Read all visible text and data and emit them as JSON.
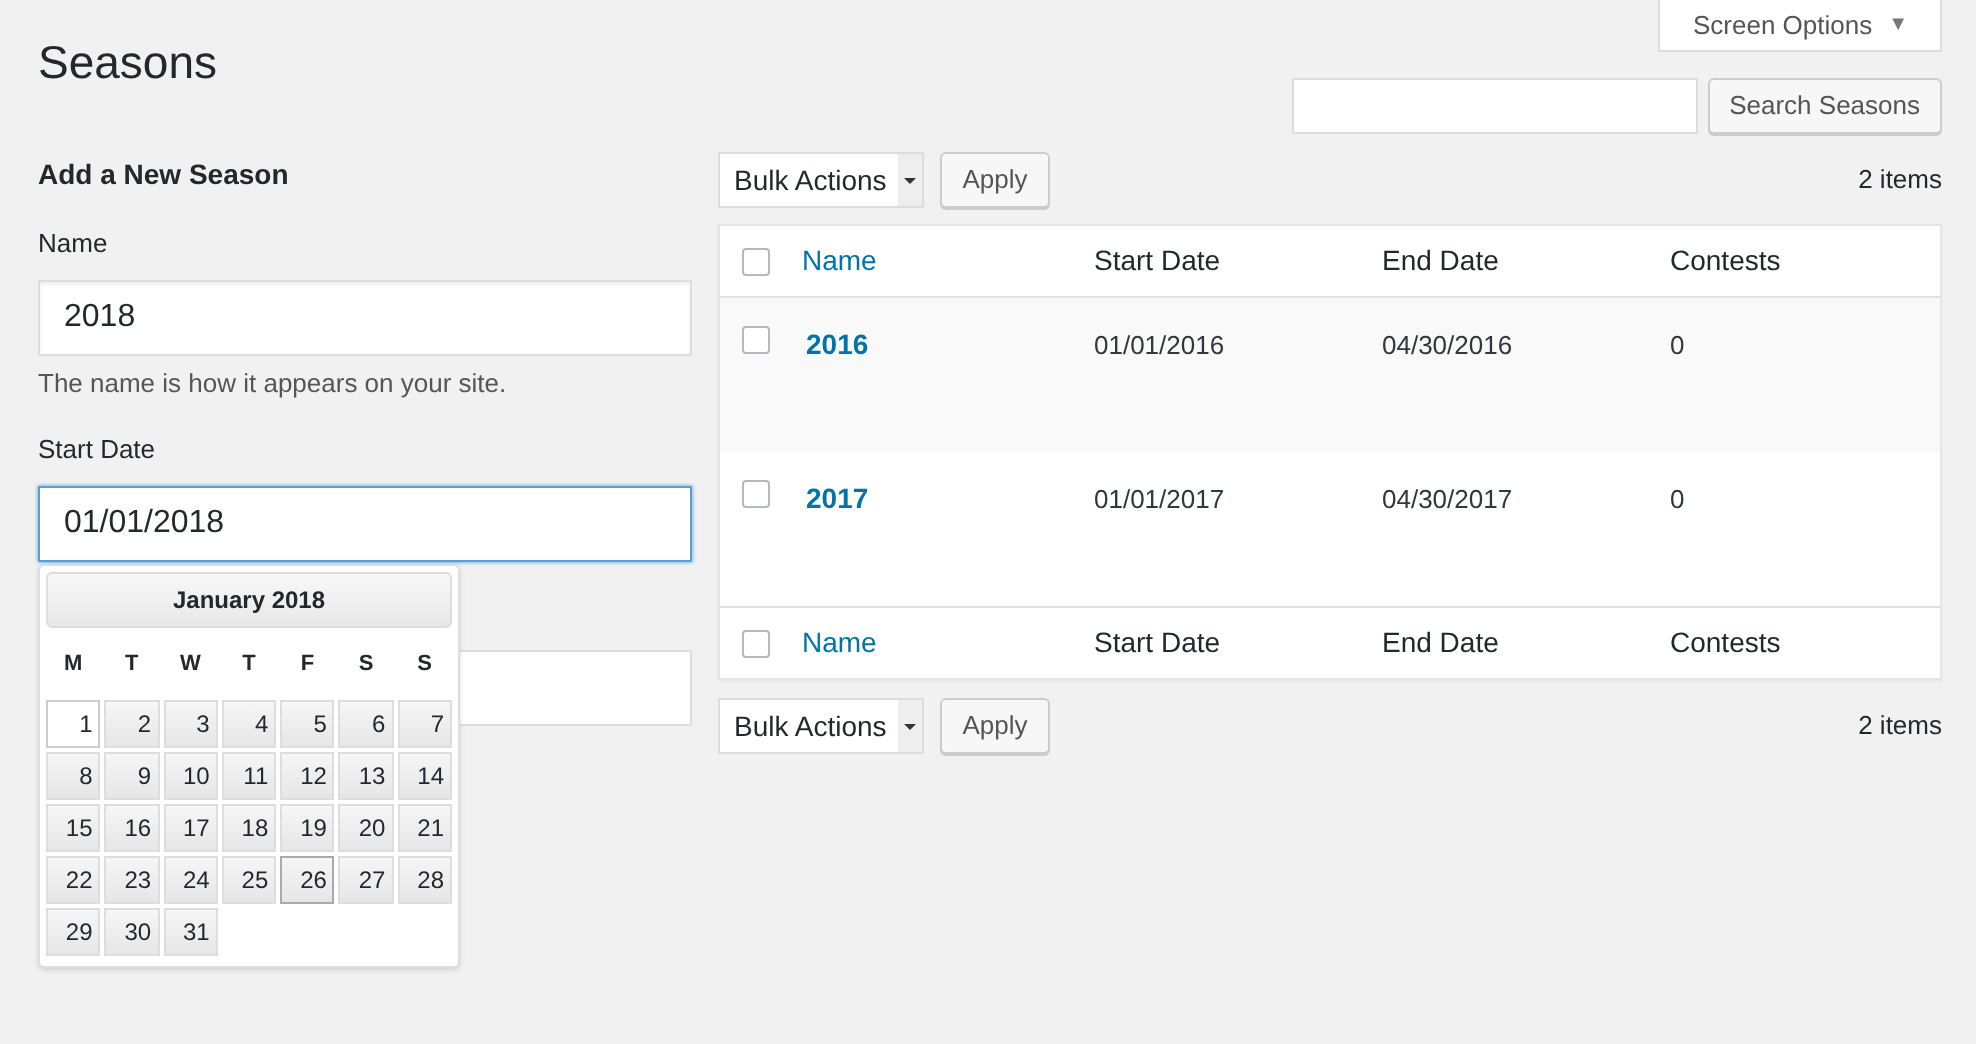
{
  "screen_options": {
    "label": "Screen Options",
    "caret": "▼"
  },
  "page_title": "Seasons",
  "search": {
    "button": "Search Seasons"
  },
  "form": {
    "heading": "Add a New Season",
    "name_field": {
      "label": "Name",
      "value": "2018",
      "hint": "The name is how it appears on your site."
    },
    "start_field": {
      "label": "Start Date",
      "value": "01/01/2018",
      "focused": true
    }
  },
  "datepicker": {
    "month": "January 2018",
    "weekdays": [
      "M",
      "T",
      "W",
      "T",
      "F",
      "S",
      "S"
    ],
    "days": [
      {
        "label": "1",
        "selected": true,
        "today": false
      },
      {
        "label": "2",
        "selected": false,
        "today": false
      },
      {
        "label": "3",
        "selected": false,
        "today": false
      },
      {
        "label": "4",
        "selected": false,
        "today": false
      },
      {
        "label": "5",
        "selected": false,
        "today": false
      },
      {
        "label": "6",
        "selected": false,
        "today": false
      },
      {
        "label": "7",
        "selected": false,
        "today": false
      },
      {
        "label": "8",
        "selected": false,
        "today": false
      },
      {
        "label": "9",
        "selected": false,
        "today": false
      },
      {
        "label": "10",
        "selected": false,
        "today": false
      },
      {
        "label": "11",
        "selected": false,
        "today": false
      },
      {
        "label": "12",
        "selected": false,
        "today": false
      },
      {
        "label": "13",
        "selected": false,
        "today": false
      },
      {
        "label": "14",
        "selected": false,
        "today": false
      },
      {
        "label": "15",
        "selected": false,
        "today": false
      },
      {
        "label": "16",
        "selected": false,
        "today": false
      },
      {
        "label": "17",
        "selected": false,
        "today": false
      },
      {
        "label": "18",
        "selected": false,
        "today": false
      },
      {
        "label": "19",
        "selected": false,
        "today": false
      },
      {
        "label": "20",
        "selected": false,
        "today": false
      },
      {
        "label": "21",
        "selected": false,
        "today": false
      },
      {
        "label": "22",
        "selected": false,
        "today": false
      },
      {
        "label": "23",
        "selected": false,
        "today": false
      },
      {
        "label": "24",
        "selected": false,
        "today": false
      },
      {
        "label": "25",
        "selected": false,
        "today": false
      },
      {
        "label": "26",
        "selected": false,
        "today": true
      },
      {
        "label": "27",
        "selected": false,
        "today": false
      },
      {
        "label": "28",
        "selected": false,
        "today": false
      },
      {
        "label": "29",
        "selected": false,
        "today": false
      },
      {
        "label": "30",
        "selected": false,
        "today": false
      },
      {
        "label": "31",
        "selected": false,
        "today": false
      }
    ]
  },
  "top_actions": {
    "bulk": "Bulk Actions",
    "apply": "Apply",
    "count": "2 items"
  },
  "table": {
    "header_checked": false,
    "footer_checked": false,
    "columns": [
      "Name",
      "Start Date",
      "End Date",
      "Contests"
    ],
    "rows": [
      {
        "checked": false,
        "cells": [
          "2016",
          "01/01/2016",
          "04/30/2016",
          "0"
        ]
      },
      {
        "checked": false,
        "cells": [
          "2017",
          "01/01/2017",
          "04/30/2017",
          "0"
        ]
      }
    ],
    "footer_columns": [
      "Name",
      "Start Date",
      "End Date",
      "Contests"
    ]
  },
  "bottom_actions": {
    "bulk": "Bulk Actions",
    "apply": "Apply",
    "count": "2 items"
  }
}
